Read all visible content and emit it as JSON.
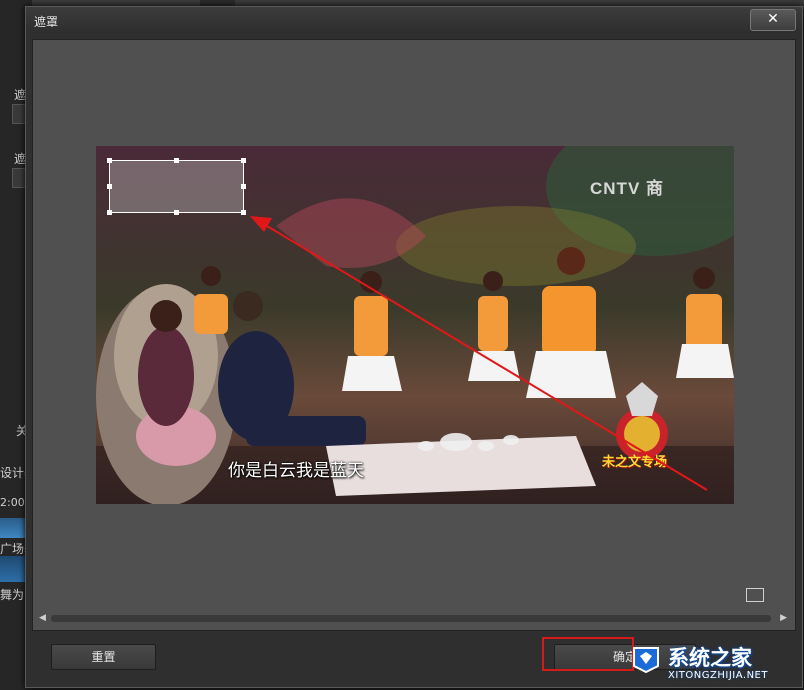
{
  "dialog": {
    "title": "遮罩",
    "close_label": "✕",
    "reset_label": "重置",
    "ok_label": "确定"
  },
  "preview": {
    "subtitle": "你是白云我是蓝天",
    "channel_logo": "CNTV 商",
    "badge_text": "未之文专场"
  },
  "background_app": {
    "left_labels": [
      "遮",
      "遮",
      "关",
      "设计器",
      "2:00",
      "广场舞",
      "舞为"
    ]
  },
  "watermark": {
    "main": "系统之家",
    "sub": "XITONGZHIJIA.NET"
  },
  "colors": {
    "dialog_bg": "#2f2f2f",
    "work_area_bg": "#505050",
    "highlight_red": "#d41a1a",
    "annotation_arrow": "#e01818",
    "watermark_blue": "#0a4ea8"
  },
  "icons": [
    "close-icon",
    "fit-screen-icon",
    "scroll-left-arrow-icon",
    "scroll-right-arrow-icon",
    "watermark-logo-icon"
  ]
}
